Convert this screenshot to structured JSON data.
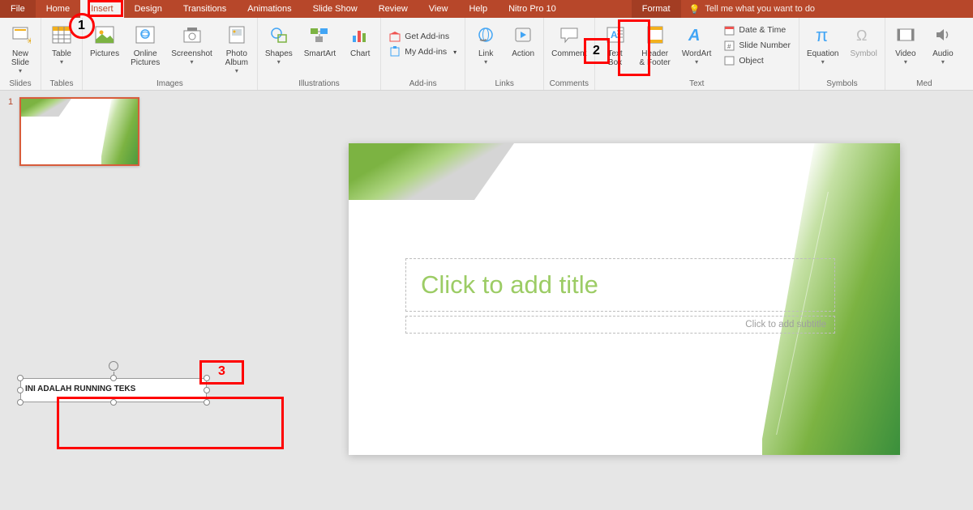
{
  "tabs": {
    "file": "File",
    "home": "Home",
    "insert": "Insert",
    "design": "Design",
    "transitions": "Transitions",
    "animations": "Animations",
    "slideshow": "Slide Show",
    "review": "Review",
    "view": "View",
    "help": "Help",
    "nitro": "Nitro Pro 10",
    "format": "Format",
    "tellme": "Tell me what you want to do"
  },
  "ribbon": {
    "slides": {
      "new_slide": "New\nSlide",
      "group": "Slides"
    },
    "tables": {
      "table": "Table",
      "group": "Tables"
    },
    "images": {
      "pictures": "Pictures",
      "online": "Online\nPictures",
      "screenshot": "Screenshot",
      "album": "Photo\nAlbum",
      "group": "Images"
    },
    "illus": {
      "shapes": "Shapes",
      "smartart": "SmartArt",
      "chart": "Chart",
      "group": "Illustrations"
    },
    "addins": {
      "get": "Get Add-ins",
      "my": "My Add-ins",
      "group": "Add-ins"
    },
    "links": {
      "link": "Link",
      "action": "Action",
      "group": "Links"
    },
    "comments": {
      "comment": "Comment",
      "group": "Comments"
    },
    "text": {
      "textbox": "Text\nBox",
      "header": "Header\n& Footer",
      "wordart": "WordArt",
      "date": "Date & Time",
      "slidenum": "Slide Number",
      "object": "Object",
      "group": "Text"
    },
    "symbols": {
      "equation": "Equation",
      "symbol": "Symbol",
      "group": "Symbols"
    },
    "media": {
      "video": "Video",
      "audio": "Audio",
      "group": "Med"
    }
  },
  "slide": {
    "num": "1",
    "title_ph": "Click to add title",
    "subtitle_ph": "Click to add subtitle"
  },
  "textbox": {
    "content": "INI ADALAH RUNNING TEKS"
  },
  "annotations": {
    "a1": "1",
    "a2": "2",
    "a3": "3"
  }
}
